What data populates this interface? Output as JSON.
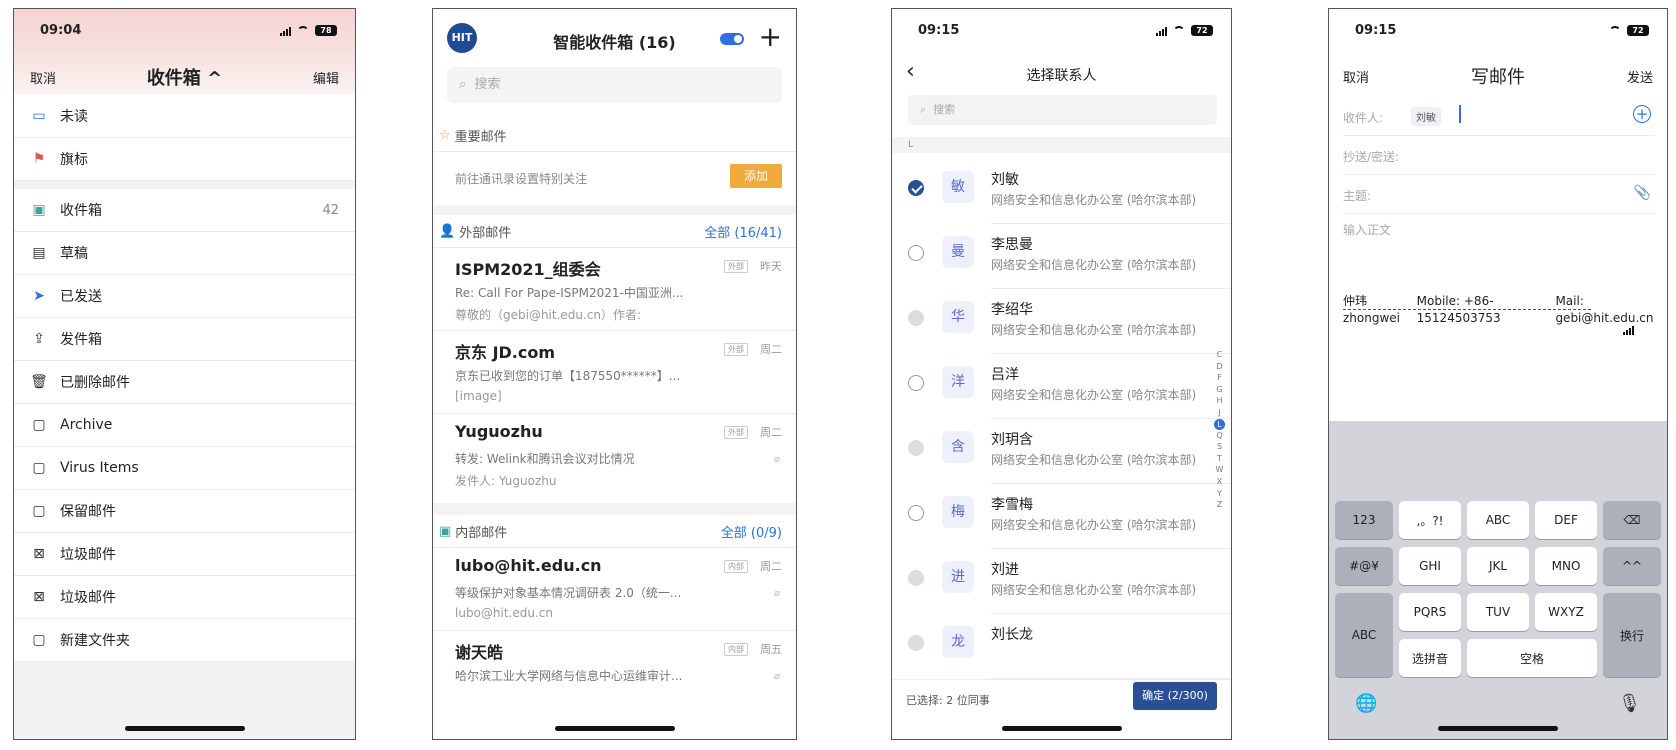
{
  "panel1": {
    "status_time": "09:04",
    "battery": "78",
    "nav_left": "取消",
    "nav_title": "收件箱 ^",
    "nav_right": "编辑",
    "groups": [
      [
        {
          "label": "未读",
          "icon": "unread-icon"
        },
        {
          "label": "旗标",
          "icon": "flag-icon"
        }
      ],
      [
        {
          "label": "收件箱",
          "icon": "inbox-icon",
          "count": "42"
        },
        {
          "label": "草稿",
          "icon": "draft-icon"
        },
        {
          "label": "已发送",
          "icon": "sent-icon"
        },
        {
          "label": "发件箱",
          "icon": "outbox-icon"
        },
        {
          "label": "已删除邮件",
          "icon": "trash-icon"
        },
        {
          "label": "Archive",
          "icon": "folder-icon"
        },
        {
          "label": "Virus Items",
          "icon": "folder-icon"
        },
        {
          "label": "保留邮件",
          "icon": "folder-icon"
        },
        {
          "label": "垃圾邮件",
          "icon": "junk-icon"
        },
        {
          "label": "垃圾邮件",
          "icon": "junk-icon"
        },
        {
          "label": "新建文件夹",
          "icon": "folder-icon"
        }
      ]
    ]
  },
  "panel2": {
    "logo": "HIT",
    "title": "智能收件箱 (16)",
    "search_placeholder": "搜索",
    "important": {
      "header": "重要邮件",
      "hint": "前往通讯录设置特别关注",
      "add": "添加"
    },
    "external": {
      "header": "外部邮件",
      "more": "全部 (16/41)",
      "mails": [
        {
          "sender": "ISPM2021_组委会",
          "subject": "Re: Call For Pape-ISPM2021-中国亚洲...",
          "preview": "尊敬的（gebi@hit.edu.cn）作者:",
          "tag": "外部",
          "day": "昨天",
          "clip": false
        },
        {
          "sender": "京东 JD.com",
          "subject": "京东已收到您的订单【187550******】...",
          "preview": "[image]",
          "tag": "外部",
          "day": "周二",
          "clip": false
        },
        {
          "sender": "Yuguozhu",
          "subject": "转发: Welink和腾讯会议对比情况",
          "preview": "发件人: Yuguozhu",
          "tag": "外部",
          "day": "周二",
          "clip": true
        }
      ]
    },
    "internal": {
      "header": "内部邮件",
      "more": "全部 (0/9)",
      "mails": [
        {
          "sender": "lubo@hit.edu.cn",
          "subject": "等级保护对象基本情况调研表 2.0（统一...",
          "preview": "lubo@hit.edu.cn",
          "tag": "内部",
          "day": "周二",
          "clip": true
        },
        {
          "sender": "谢天皓",
          "subject": "哈尔滨工业大学网络与信息中心运维审计...",
          "preview": "",
          "tag": "内部",
          "day": "周五",
          "clip": true
        }
      ]
    }
  },
  "panel3": {
    "status_time": "09:15",
    "battery": "72",
    "title": "选择联系人",
    "search_placeholder": "搜索",
    "letter": "L",
    "contacts": [
      {
        "name": "刘敏",
        "avatar": "敏",
        "dept": "网络安全和信息化办公室 (哈尔滨本部)",
        "state": "checked"
      },
      {
        "name": "李思曼",
        "avatar": "曼",
        "dept": "网络安全和信息化办公室 (哈尔滨本部)",
        "state": "empty"
      },
      {
        "name": "李绍华",
        "avatar": "华",
        "dept": "网络安全和信息化办公室 (哈尔滨本部)",
        "state": "disabled"
      },
      {
        "name": "吕洋",
        "avatar": "洋",
        "dept": "网络安全和信息化办公室 (哈尔滨本部)",
        "state": "empty"
      },
      {
        "name": "刘玥含",
        "avatar": "含",
        "dept": "网络安全和信息化办公室 (哈尔滨本部)",
        "state": "disabled"
      },
      {
        "name": "李雪梅",
        "avatar": "梅",
        "dept": "网络安全和信息化办公室 (哈尔滨本部)",
        "state": "empty"
      },
      {
        "name": "刘进",
        "avatar": "进",
        "dept": "网络安全和信息化办公室 (哈尔滨本部)",
        "state": "disabled"
      },
      {
        "name": "刘长龙",
        "avatar": "龙",
        "dept": "",
        "state": "disabled"
      }
    ],
    "index_letters": [
      "C",
      "D",
      "F",
      "G",
      "H",
      "J",
      "L",
      "Q",
      "S",
      "T",
      "W",
      "X",
      "Y",
      "Z"
    ],
    "index_active": "L",
    "selected_text": "已选择: 2 位同事",
    "confirm": "确定 (2/300)"
  },
  "panel4": {
    "status_time": "09:15",
    "battery": "72",
    "nav_left": "取消",
    "title": "写邮件",
    "nav_right": "发送",
    "to_label": "收件人:",
    "to_chip": "刘敏",
    "cc_label": "抄送/密送:",
    "subject_label": "主题:",
    "body_placeholder": "输入正文",
    "signature": [
      "仲玮 zhongwei",
      "Mobile:  +86-15124503753",
      "Mail:  gebi@hit.edu.cn"
    ],
    "keys": {
      "k123": "123",
      "punct": ",。?!",
      "abc": "ABC",
      "def": "DEF",
      "sym": "#@¥",
      "ghi": "GHI",
      "jkl": "JKL",
      "mno": "MNO",
      "emoji": "^^",
      "abc2": "ABC",
      "pqrs": "PQRS",
      "tuv": "TUV",
      "wxyz": "WXYZ",
      "enter": "换行",
      "pinyin": "选拼音",
      "space": "空格"
    }
  }
}
